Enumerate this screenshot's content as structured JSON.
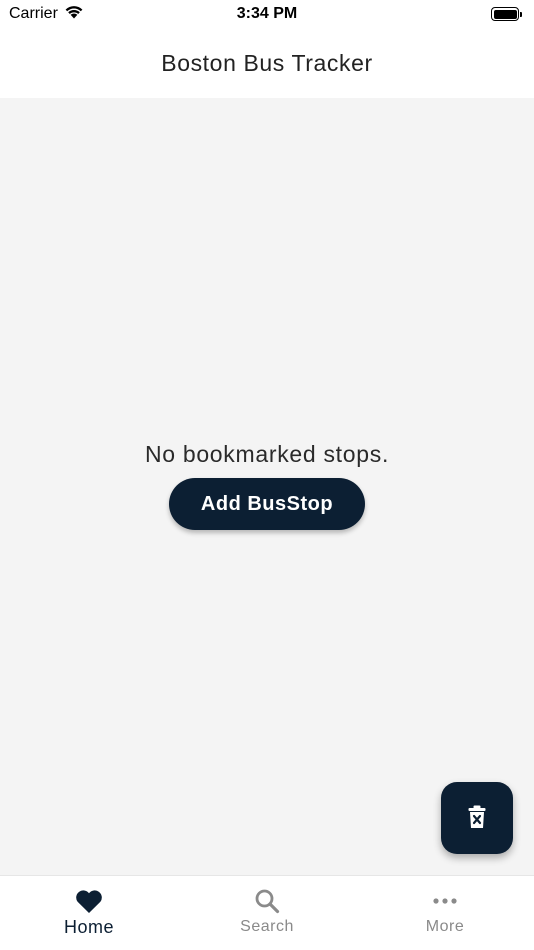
{
  "status_bar": {
    "carrier": "Carrier",
    "time": "3:34 PM",
    "icons": [
      "wifi-icon",
      "battery-icon"
    ]
  },
  "header": {
    "title": "Boston Bus Tracker"
  },
  "main": {
    "empty_message": "No bookmarked stops.",
    "add_button_label": "Add BusStop",
    "fab_icon": "delete-icon"
  },
  "tabs": [
    {
      "label": "Home",
      "icon": "heart-icon",
      "active": true
    },
    {
      "label": "Search",
      "icon": "search-icon",
      "active": false
    },
    {
      "label": "More",
      "icon": "more-icon",
      "active": false
    }
  ],
  "colors": {
    "primary": "#0c1f33",
    "background": "#f4f4f4",
    "inactive": "#8a8a8a"
  }
}
